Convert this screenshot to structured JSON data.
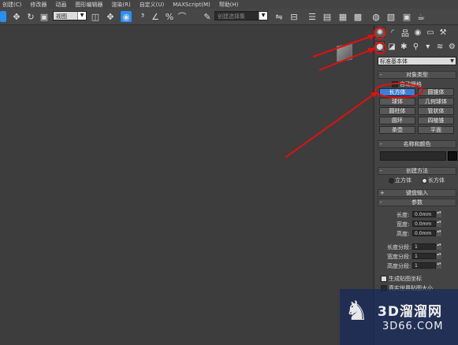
{
  "menu": [
    "创建(C)",
    "修改器",
    "动画",
    "图形编辑器",
    "渲染(R)",
    "自定义(U)",
    "MAXScript(M)",
    "帮助(H)"
  ],
  "toolbar": {
    "view_dropdown": "视图",
    "selection_set_dropdown": "创建选择集"
  },
  "panel": {
    "category_dropdown": "标准基本体",
    "object_type": {
      "title": "对象类型",
      "autogrid_label": "自动栅格",
      "buttons": [
        "长方体",
        "圆锥体",
        "球体",
        "几何球体",
        "圆柱体",
        "管状体",
        "圆环",
        "四棱锥",
        "茶壶",
        "平面"
      ],
      "selected": "长方体"
    },
    "name_color": {
      "title": "名称和颜色"
    },
    "creation_method": {
      "title": "创建方法",
      "options": [
        "立方体",
        "长方体"
      ],
      "selected": "长方体"
    },
    "keyboard_entry": {
      "title": "键盘输入"
    },
    "parameters": {
      "title": "参数",
      "length_label": "长度:",
      "length_value": "0.0mm",
      "width_label": "宽度:",
      "width_value": "0.0mm",
      "height_label": "高度:",
      "height_value": "0.0mm",
      "length_segs_label": "长度分段:",
      "length_segs_value": "1",
      "width_segs_label": "宽度分段:",
      "width_segs_value": "1",
      "height_segs_label": "高度分段:",
      "height_segs_value": "1",
      "gen_map_label": "生成贴图坐标",
      "real_world_label": "真实世界贴图大小"
    }
  },
  "watermark": {
    "line1": "3D溜溜网",
    "line2": "3D66.COM"
  },
  "colors": {
    "accent": "#3d7fd8",
    "annotation": "#e01010"
  }
}
